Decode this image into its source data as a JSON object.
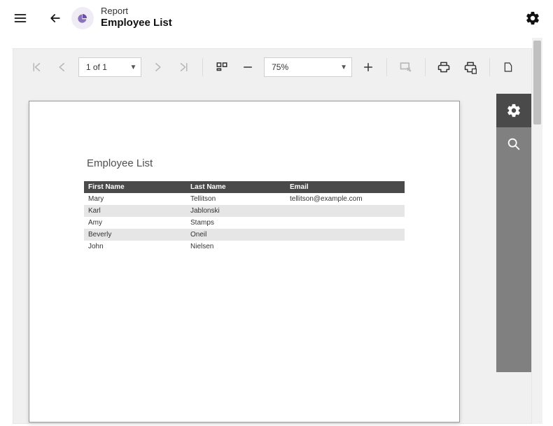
{
  "header": {
    "category": "Report",
    "title": "Employee List"
  },
  "toolbar": {
    "page_label": "1 of 1",
    "zoom_label": "75%"
  },
  "report": {
    "title": "Employee List",
    "columns": [
      "First Name",
      "Last Name",
      "Email"
    ],
    "rows": [
      {
        "first": "Mary",
        "last": "Tellitson",
        "email": "tellitson@example.com"
      },
      {
        "first": "Karl",
        "last": "Jablonski",
        "email": ""
      },
      {
        "first": "Amy",
        "last": "Stamps",
        "email": ""
      },
      {
        "first": "Beverly",
        "last": "Oneil",
        "email": ""
      },
      {
        "first": "John",
        "last": "Nielsen",
        "email": ""
      }
    ]
  }
}
